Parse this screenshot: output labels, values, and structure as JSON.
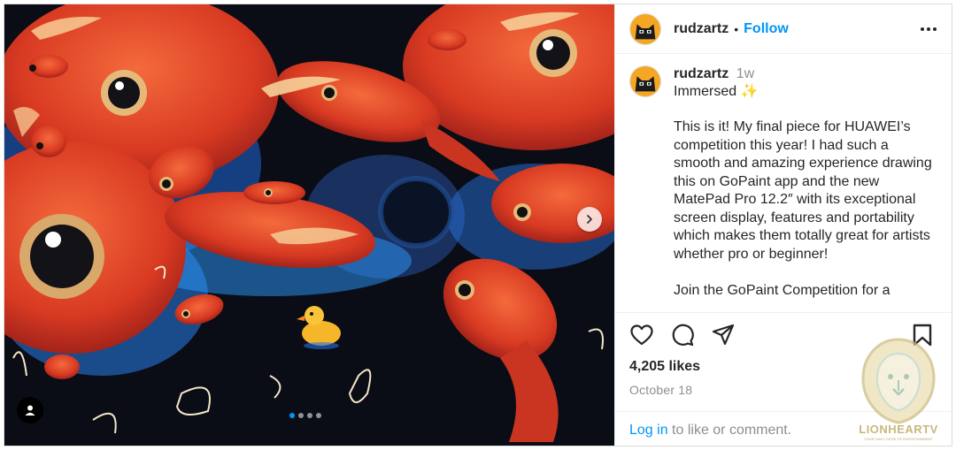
{
  "media": {
    "carousel_page_count": 4,
    "carousel_active_index": 0
  },
  "header": {
    "username": "rudzartz",
    "separator": "•",
    "follow_label": "Follow"
  },
  "caption": {
    "username": "rudzartz",
    "time_ago": "1w",
    "title": "Immersed",
    "title_emoji": "✨",
    "text": "This is it! My final piece for HUAWEI’s competition this year! I had such a smooth and amazing experience drawing this on GoPaint app and the new MatePad Pro 12.2″ with its exceptional screen display, features and portability which makes them totally great for artists whether pro or beginner!\n\nJoin the GoPaint Competition for a"
  },
  "actions": {
    "likes": "4,205 likes",
    "date": "October 18",
    "login_link": "Log in",
    "login_rest": " to like or comment."
  },
  "watermark": {
    "text": "LIONHEARTV",
    "subtext": "YOUR DAILY DOSE OF ENTERTAINMENT"
  },
  "icons": [
    "chevron-right-icon",
    "user-tag-icon",
    "more-icon",
    "heart-icon",
    "comment-icon",
    "share-icon",
    "bookmark-icon",
    "lion-logo-icon"
  ],
  "colors": {
    "accent": "#0095f6",
    "text": "#262626",
    "muted": "#8e8e8e",
    "fish_red": "#e2452a",
    "water_blue": "#2aa0ff"
  }
}
